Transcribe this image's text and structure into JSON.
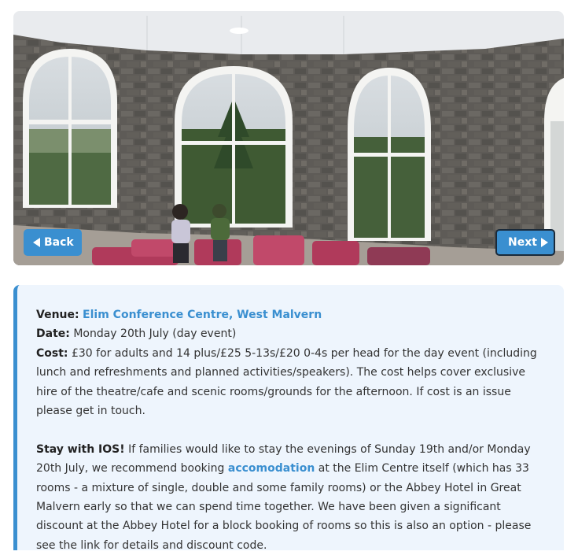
{
  "gallery": {
    "back_label": "Back",
    "next_label": "Next",
    "back_icon": "triangle-left-icon",
    "next_icon": "triangle-right-icon"
  },
  "event": {
    "venue_label": "Venue:",
    "venue_value": "Elim Conference Centre, West Malvern",
    "date_label": "Date:",
    "date_value": "Monday 20th July (day event)",
    "cost_label": "Cost:",
    "cost_value": "£30 for adults and 14 plus/£25 5-13s/£20 0-4s per head for the day event (including lunch and refreshments and planned activities/speakers). The cost helps cover exclusive hire of the theatre/cafe and scenic rooms/grounds for the afternoon. If cost is an issue please get in touch.",
    "stay_label": "Stay with IOS!",
    "stay_text_1": "If families would like to stay the evenings of Sunday 19th and/or Monday 20th July, we recommend booking",
    "stay_link": "accomodation",
    "stay_text_2": "at the Elim Centre itself (which has 33 rooms - a mixture of single, double and some family rooms) or the Abbey Hotel in Great Malvern early so that we can spend time together. We have been given a significant discount at the Abbey Hotel for a block booking of rooms so this is also an option - please see the link for details and discount code."
  },
  "colors": {
    "accent": "#3a8fd0",
    "panel_bg": "#eef5fd"
  }
}
